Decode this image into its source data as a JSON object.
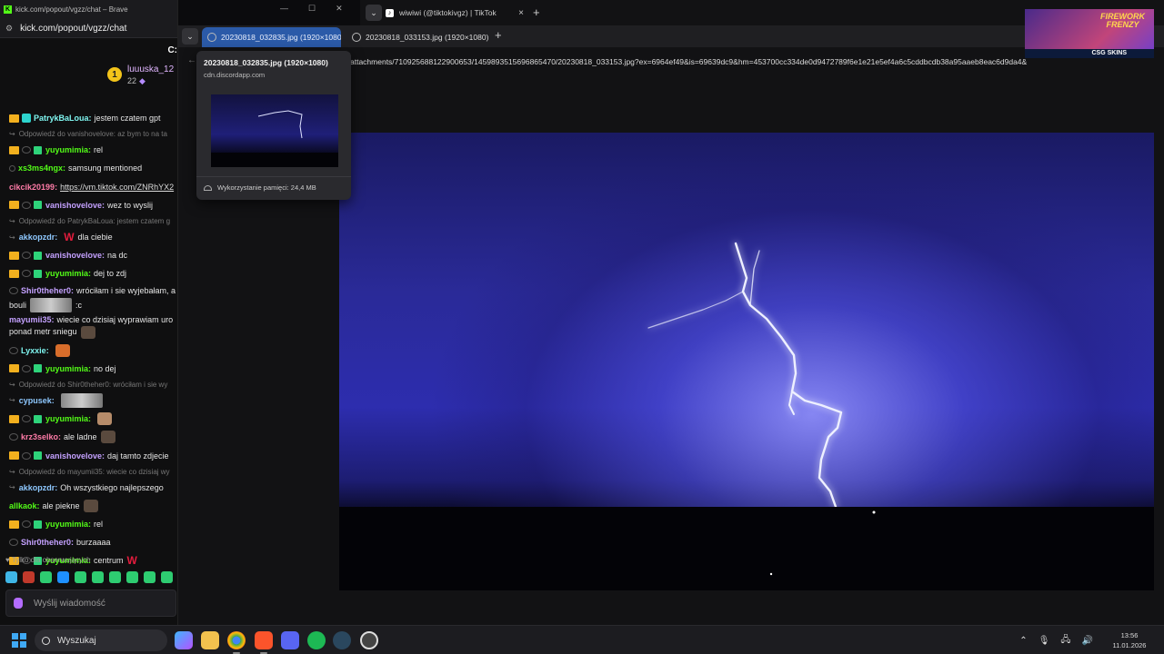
{
  "left_window": {
    "title": "kick.com/popout/vgzz/chat – Brave",
    "url": "kick.com/popout/vgzz/chat",
    "header_fragment": "C:",
    "pinned_user": {
      "name": "luuuska_12",
      "count": "22",
      "badge": "1"
    },
    "messages": [
      {
        "kind": "msg",
        "user": "PatrykBaLoua",
        "color": "teal",
        "badges": [
          "crown",
          "teal"
        ],
        "text": "jestem czatem gpt"
      },
      {
        "kind": "reply",
        "text": "Odpowiedź do vanishovelove: az bym to na ta"
      },
      {
        "kind": "msg",
        "user": "yuyumimia",
        "color": "green",
        "badges": [
          "crown",
          "moon",
          "gift"
        ],
        "text": "rel"
      },
      {
        "kind": "msg",
        "user": "xs3ms4ngx",
        "color": "green",
        "badges": [
          "dot"
        ],
        "text": "samsung mentioned"
      },
      {
        "kind": "msg",
        "user": "cikcik20199",
        "color": "pink",
        "badges": [],
        "text": "",
        "link": "https://vm.tiktok.com/ZNRhYX2"
      },
      {
        "kind": "msg",
        "user": "vanishovelove",
        "color": "purple",
        "badges": [
          "crown",
          "moon",
          "gift"
        ],
        "text": "wez to wyslij"
      },
      {
        "kind": "reply",
        "text": "Odpowiedź do PatrykBaLoua: jestem czatem g"
      },
      {
        "kind": "msg",
        "user": "akkopzdr",
        "color": "cyan",
        "badges": [
          "hook"
        ],
        "text": "dla ciebie",
        "w_before": true
      },
      {
        "kind": "msg",
        "user": "vanishovelove",
        "color": "purple",
        "badges": [
          "crown",
          "moon",
          "gift"
        ],
        "text": "na dc"
      },
      {
        "kind": "msg",
        "user": "yuyumimia",
        "color": "green",
        "badges": [
          "crown",
          "moon",
          "gift"
        ],
        "text": "dej to zdj"
      },
      {
        "kind": "two",
        "user": "Shir0theher0",
        "color": "purple",
        "badges": [
          "moon"
        ],
        "text": "wróciłam i sie wyjebałam, a",
        "text2": "bouli",
        "text3": ":c",
        "emote": "wide"
      },
      {
        "kind": "two",
        "user": "mayumii35",
        "color": "purple",
        "badges": [],
        "text": "wiecie co dzisiaj wyprawiam uro",
        "text2": "ponad metr sniegu",
        "emote": "e3"
      },
      {
        "kind": "msg",
        "user": "Lyxxie",
        "color": "teal",
        "badges": [
          "moon"
        ],
        "text": "",
        "emote": "e1"
      },
      {
        "kind": "msg",
        "user": "yuyumimia",
        "color": "green",
        "badges": [
          "crown",
          "moon",
          "gift"
        ],
        "text": "no dej"
      },
      {
        "kind": "reply",
        "text": "Odpowiedź do Shir0theher0: wróciłam i sie wy"
      },
      {
        "kind": "msg",
        "user": "cypusek",
        "color": "cyan",
        "badges": [
          "hook"
        ],
        "text": "",
        "emote": "wide"
      },
      {
        "kind": "msg",
        "user": "yuyumimia",
        "color": "green",
        "badges": [
          "crown",
          "moon",
          "gift"
        ],
        "text": "",
        "emote": "e2"
      },
      {
        "kind": "msg",
        "user": "krz3selko",
        "color": "pink",
        "badges": [
          "moon"
        ],
        "text": "ale ladne",
        "emote": "e3"
      },
      {
        "kind": "msg",
        "user": "vanishovelove",
        "color": "purple",
        "badges": [
          "crown",
          "moon",
          "gift"
        ],
        "text": "daj tamto zdjecie"
      },
      {
        "kind": "reply",
        "text": "Odpowiedź do mayumii35: wiecie co dzisiaj wy"
      },
      {
        "kind": "msg",
        "user": "akkopzdr",
        "color": "cyan",
        "badges": [
          "hook"
        ],
        "text": "Oh wszystkiego najlepszego"
      },
      {
        "kind": "msg",
        "user": "allkaok",
        "color": "green",
        "badges": [],
        "text": "ale piekne",
        "emote": "e3"
      },
      {
        "kind": "msg",
        "user": "yuyumimia",
        "color": "green",
        "badges": [
          "crown",
          "moon",
          "gift"
        ],
        "text": "rel"
      },
      {
        "kind": "msg",
        "user": "Shir0theher0",
        "color": "purple",
        "badges": [
          "moon"
        ],
        "text": "burzaaaa"
      },
      {
        "kind": "msg",
        "user": "yuyumimia",
        "color": "green",
        "badges": [
          "crown",
          "moon",
          "gift"
        ],
        "text": "centrum",
        "w_after": true
      }
    ],
    "followers_only": "Tylko dla obserwujących",
    "input_placeholder": "Wyślij wiadomość"
  },
  "browser": {
    "tabs": [
      {
        "label": "20230818_032835.jpg (1920×1080)",
        "active": true
      },
      {
        "label": "20230818_033153.jpg (1920×1080)",
        "active": false
      }
    ],
    "other_window_tab": "wiwiwi (@tiktokivgz) | TikTok",
    "address": "attachments/710925688122900653/1459893515696865470/20230818_033153.jpg?ex=6964ef49&is=69639dc9&hm=453700cc334de0d9472789f6e1e21e5ef4a6c5cddbcdb38a95aaeb8eac6d9da4&",
    "hovercard": {
      "title": "20230818_032835.jpg (1920×1080)",
      "domain": "cdn.discordapp.com",
      "memory": "Wykorzystanie pamięci: 24,4 MB"
    }
  },
  "overlay": {
    "title_line1": "FIREWORK",
    "title_line2": "FRENZY",
    "brand": "CSG SKINS"
  },
  "taskbar": {
    "search_placeholder": "Wyszukaj",
    "time": "13:56",
    "date": "11.01.2026",
    "apps": [
      "copilot-icon",
      "file-explorer-icon",
      "chrome-icon",
      "brave-icon",
      "discord-icon",
      "spotify-icon",
      "steam-icon",
      "app-icon"
    ],
    "colors": {
      "accent": "#3fa9f5"
    }
  }
}
